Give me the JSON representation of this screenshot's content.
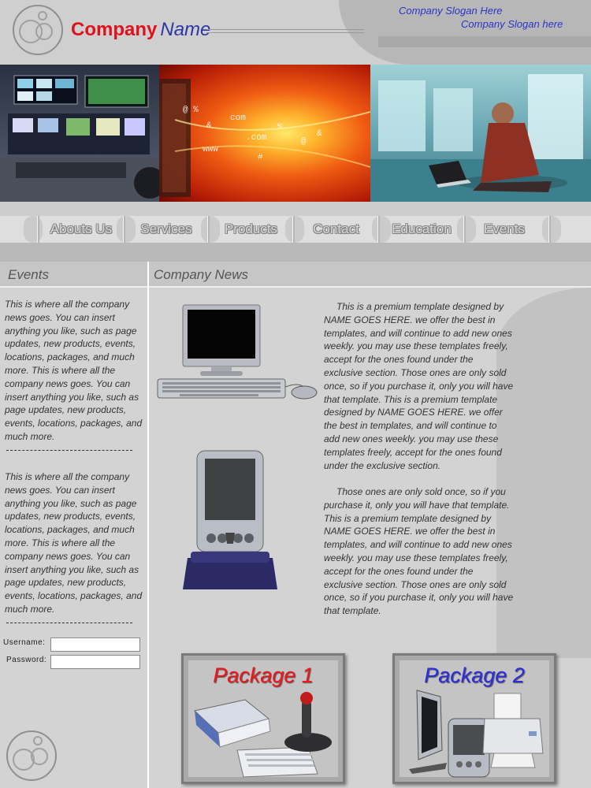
{
  "header": {
    "company": "Company",
    "name": "Name",
    "slogan_line1": "Company Slogan Here",
    "slogan_line2": "Company Slogan here"
  },
  "nav": {
    "items": [
      "Abouts Us",
      "Services",
      "Products",
      "Contact",
      "Education",
      "Events"
    ]
  },
  "sidebar": {
    "title": "Events",
    "paragraphs": [
      "This is where all the company news goes.  You can insert anything you like, such as page updates, new products, events, locations, packages, and much more. This is where all the company news goes.  You can insert anything you like, such as page updates, new products, events, locations, packages, and much more.",
      "This is where all the company news goes.  You can insert anything you like, such as page updates, new products, events, locations, packages, and much more. This is where all the company news goes.  You can insert anything you like, such as page updates, new products, events, locations, packages, and much more."
    ],
    "username_label": "Username:",
    "password_label": "Password:",
    "username_value": "",
    "password_value": ""
  },
  "main": {
    "title": "Company News",
    "paragraphs": [
      "This is a premium template designed by NAME GOES HERE.  we offer the best in templates, and will continue to add new ones weekly.  you may use these templates freely, accept for the ones found under the exclusive section.  Those ones are only sold once, so if you purchase it, only you will have that template.  This is a premium template designed by NAME GOES HERE.  we offer the best in templates, and will continue to add new ones weekly.  you may use these templates freely, accept for the ones found under the exclusive section.",
      "Those ones are only sold once, so if you purchase it, only you will have that template. This is a premium template designed by NAME GOES HERE.  we offer the best in templates, and will continue to add new ones weekly.  you may use these templates freely, accept for the ones found under the exclusive section.  Those ones are only sold once, so if you purchase it, only you will have that template."
    ]
  },
  "packages": [
    {
      "title": "Package 1"
    },
    {
      "title": "Package 2"
    }
  ],
  "colors": {
    "brand_red": "#e0111b",
    "brand_blue": "#2a35a8",
    "slogan_blue": "#2a35c9",
    "background_gray": "#cfcfcf"
  }
}
